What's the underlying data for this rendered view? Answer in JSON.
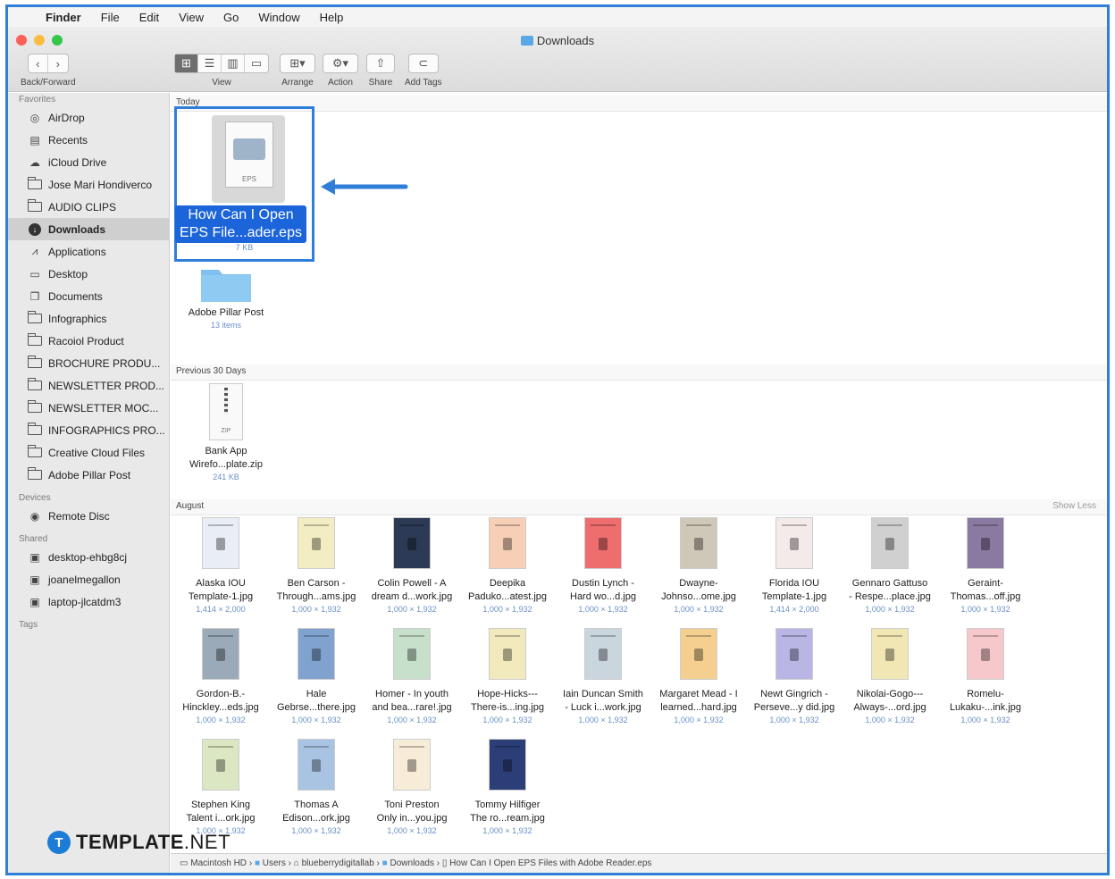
{
  "menu": {
    "app": "Finder",
    "items": [
      "File",
      "Edit",
      "View",
      "Go",
      "Window",
      "Help"
    ]
  },
  "window": {
    "title": "Downloads"
  },
  "toolbar": {
    "back_forward": "Back/Forward",
    "view": "View",
    "arrange": "Arrange",
    "action": "Action",
    "share": "Share",
    "add_tags": "Add Tags"
  },
  "sidebar": {
    "favorites_label": "Favorites",
    "favorites": [
      {
        "label": "AirDrop",
        "icon": "airdrop-icon"
      },
      {
        "label": "Recents",
        "icon": "recents-icon"
      },
      {
        "label": "iCloud Drive",
        "icon": "icloud-icon"
      },
      {
        "label": "Jose Mari Hondiverco",
        "icon": "folder-icon"
      },
      {
        "label": "AUDIO CLIPS",
        "icon": "folder-icon"
      },
      {
        "label": "Downloads",
        "icon": "downloads-icon",
        "selected": true
      },
      {
        "label": "Applications",
        "icon": "applications-icon"
      },
      {
        "label": "Desktop",
        "icon": "desktop-icon"
      },
      {
        "label": "Documents",
        "icon": "documents-icon"
      },
      {
        "label": "Infographics",
        "icon": "folder-icon"
      },
      {
        "label": "Racoiol Product",
        "icon": "folder-icon"
      },
      {
        "label": "BROCHURE PRODU...",
        "icon": "folder-icon"
      },
      {
        "label": "NEWSLETTER PROD...",
        "icon": "folder-icon"
      },
      {
        "label": "NEWSLETTER MOC...",
        "icon": "folder-icon"
      },
      {
        "label": "INFOGRAPHICS PRO...",
        "icon": "folder-icon"
      },
      {
        "label": "Creative Cloud Files",
        "icon": "folder-icon"
      },
      {
        "label": "Adobe Pillar Post",
        "icon": "folder-icon"
      }
    ],
    "devices_label": "Devices",
    "devices": [
      {
        "label": "Remote Disc",
        "icon": "disc-icon"
      }
    ],
    "shared_label": "Shared",
    "shared": [
      {
        "label": "desktop-ehbg8cj",
        "icon": "computer-icon"
      },
      {
        "label": "joanelmegallon",
        "icon": "computer-icon"
      },
      {
        "label": "laptop-jlcatdm3",
        "icon": "computer-icon"
      }
    ],
    "tags_label": "Tags"
  },
  "sections": {
    "today": "Today",
    "previous": "Previous 30 Days",
    "august": "August",
    "show_less": "Show Less"
  },
  "today_files": [
    {
      "name": "How Can I Open EPS File...ader.eps",
      "name1": "How Can I Open",
      "name2": "EPS File...ader.eps",
      "meta": "7 KB",
      "badge": "EPS"
    },
    {
      "name": "Adobe Pillar Post",
      "meta": "13 items"
    }
  ],
  "previous_files": [
    {
      "name1": "Bank App",
      "name2": "Wirefo...plate.zip",
      "meta": "241 KB",
      "badge": "ZIP"
    }
  ],
  "august_files": [
    {
      "name1": "Alaska IOU",
      "name2": "Template-1.jpg",
      "meta": "1,414 × 2,000",
      "color": "#e9eef6"
    },
    {
      "name1": "Ben Carson -",
      "name2": "Through...ams.jpg",
      "meta": "1,000 × 1,932",
      "color": "#f3edc4"
    },
    {
      "name1": "Colin Powell - A",
      "name2": "dream d...work.jpg",
      "meta": "1,000 × 1,932",
      "color": "#2c3a55"
    },
    {
      "name1": "Deepika",
      "name2": "Paduko...atest.jpg",
      "meta": "1,000 × 1,932",
      "color": "#f6cfb6"
    },
    {
      "name1": "Dustin Lynch -",
      "name2": "Hard wo...d.jpg",
      "meta": "1,000 × 1,932",
      "color": "#ee6d6d"
    },
    {
      "name1": "Dwayne-",
      "name2": "Johnso...ome.jpg",
      "meta": "1,000 × 1,932",
      "color": "#cfc7b7"
    },
    {
      "name1": "Florida IOU",
      "name2": "Template-1.jpg",
      "meta": "1,414 × 2,000",
      "color": "#f4eaea"
    },
    {
      "name1": "Gennaro Gattuso",
      "name2": "- Respe...place.jpg",
      "meta": "1,000 × 1,932",
      "color": "#cfd0cf"
    },
    {
      "name1": "Geraint-",
      "name2": "Thomas...off.jpg",
      "meta": "1,000 × 1,932",
      "color": "#8a7aa1"
    },
    {
      "name1": "Gordon-B.-",
      "name2": "Hinckley...eds.jpg",
      "meta": "1,000 × 1,932",
      "color": "#9aaab8"
    },
    {
      "name1": "Hale",
      "name2": "Gebrse...there.jpg",
      "meta": "1,000 × 1,932",
      "color": "#7fa2cf"
    },
    {
      "name1": "Homer - In youth",
      "name2": "and bea...rare!.jpg",
      "meta": "1,000 × 1,932",
      "color": "#c7e0cb"
    },
    {
      "name1": "Hope-Hicks---",
      "name2": "There-is...ing.jpg",
      "meta": "1,000 × 1,932",
      "color": "#f2e9bd"
    },
    {
      "name1": "Iain Duncan Smith",
      "name2": "- Luck i...work.jpg",
      "meta": "1,000 × 1,932",
      "color": "#c9d6dd"
    },
    {
      "name1": "Margaret Mead - I",
      "name2": "learned...hard.jpg",
      "meta": "1,000 × 1,932",
      "color": "#f4cf90"
    },
    {
      "name1": "Newt Gingrich -",
      "name2": "Perseve...y did.jpg",
      "meta": "1,000 × 1,932",
      "color": "#b9b6e6"
    },
    {
      "name1": "Nikolai-Gogo---",
      "name2": "Always-...ord.jpg",
      "meta": "1,000 × 1,932",
      "color": "#f0e7b5"
    },
    {
      "name1": "Romelu-",
      "name2": "Lukaku-...ink.jpg",
      "meta": "1,000 × 1,932",
      "color": "#f6c8cc"
    },
    {
      "name1": "Stephen King",
      "name2": "Talent i...ork.jpg",
      "meta": "1,000 × 1,932",
      "color": "#dbe7c2"
    },
    {
      "name1": "Thomas A",
      "name2": "Edison...ork.jpg",
      "meta": "1,000 × 1,932",
      "color": "#a9c3e3"
    },
    {
      "name1": "Toni Preston",
      "name2": "Only in...you.jpg",
      "meta": "1,000 × 1,932",
      "color": "#f7ecd8"
    },
    {
      "name1": "Tommy Hilfiger",
      "name2": "The ro...ream.jpg",
      "meta": "1,000 × 1,932",
      "color": "#2b3e78"
    }
  ],
  "pathbar": [
    "Macintosh HD",
    "Users",
    "blueberrydigitallab",
    "Downloads",
    "How Can I Open EPS Files with Adobe Reader.eps"
  ],
  "brand": {
    "mark": "T",
    "word": "TEMPLATE",
    "suffix": ".NET"
  },
  "colors": {
    "accent": "#2f7ed8",
    "selection": "#1b64d9",
    "folder": "#5aa7e8"
  }
}
